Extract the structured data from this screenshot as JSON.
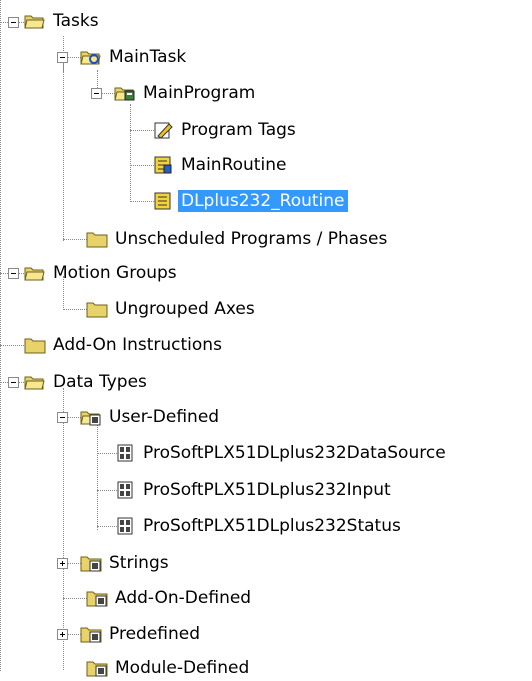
{
  "tree": {
    "tasks": "Tasks",
    "main_task": "MainTask",
    "main_program": "MainProgram",
    "program_tags": "Program Tags",
    "main_routine": "MainRoutine",
    "dlplus_routine": "DLplus232_Routine",
    "unscheduled": "Unscheduled Programs / Phases",
    "motion_groups": "Motion Groups",
    "ungrouped_axes": "Ungrouped Axes",
    "add_on_instructions": "Add-On Instructions",
    "data_types": "Data Types",
    "user_defined": "User-Defined",
    "udt1": "ProSoftPLX51DLplus232DataSource",
    "udt2": "ProSoftPLX51DLplus232Input",
    "udt3": "ProSoftPLX51DLplus232Status",
    "strings": "Strings",
    "add_on_defined": "Add-On-Defined",
    "predefined": "Predefined",
    "module_defined": "Module-Defined"
  },
  "colors": {
    "selection": "#3399ff",
    "folder": "#e8d26a"
  },
  "selected_item": "DLplus232_Routine"
}
